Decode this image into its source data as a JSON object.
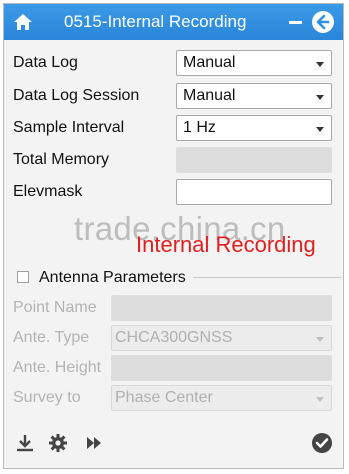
{
  "window": {
    "title": "0515-Internal Recording",
    "icons": {
      "home": "home-icon",
      "minimize": "minimize-icon",
      "back": "back-arrow-icon"
    },
    "accent_color": "#2f8fe0"
  },
  "form": {
    "data_log": {
      "label": "Data Log",
      "value": "Manual"
    },
    "data_log_session": {
      "label": "Data Log Session",
      "value": "Manual"
    },
    "sample_interval": {
      "label": "Sample Interval",
      "value": "1 Hz"
    },
    "total_memory": {
      "label": "Total Memory",
      "value": ""
    },
    "elevmask": {
      "label": "Elevmask",
      "value": ""
    }
  },
  "watermark": "trade.china.cn",
  "mode_label": "Internal Recording",
  "antenna": {
    "section_label": "Antenna Parameters",
    "checked": false,
    "point_name": {
      "label": "Point Name",
      "value": ""
    },
    "ante_type": {
      "label": "Ante. Type",
      "value": "CHCA300GNSS"
    },
    "ante_height": {
      "label": "Ante. Height",
      "value": ""
    },
    "survey_to": {
      "label": "Survey to",
      "value": "Phase Center"
    }
  },
  "toolbar": {
    "icons": [
      "download-icon",
      "settings-gear-icon",
      "fast-forward-icon",
      "confirm-check-icon"
    ]
  }
}
